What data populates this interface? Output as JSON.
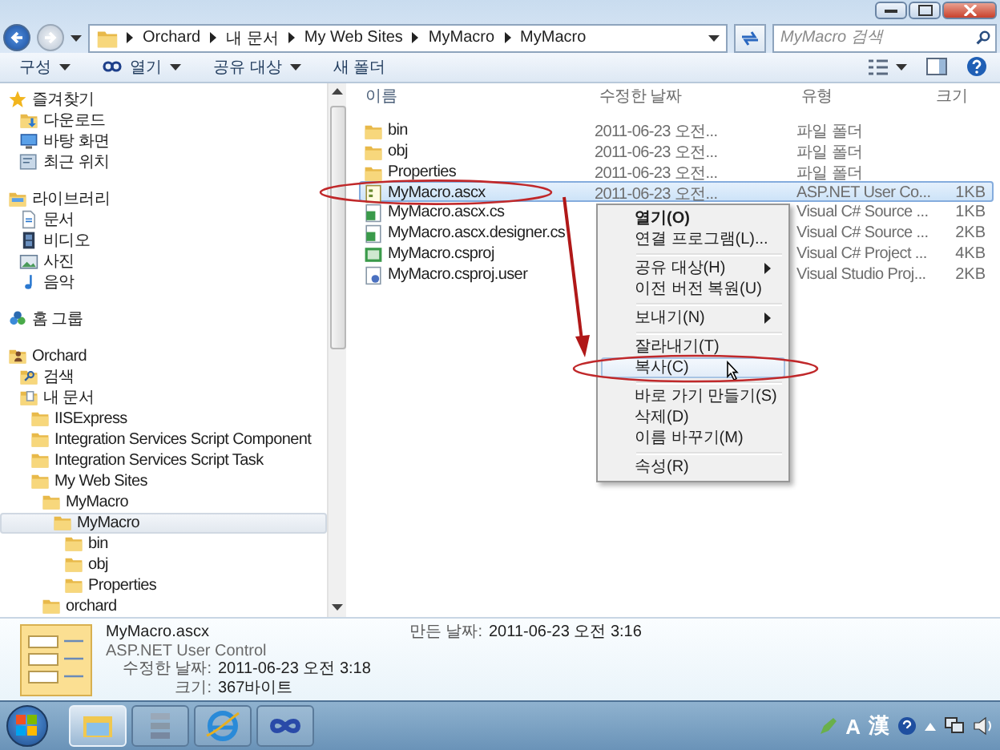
{
  "address_bar": {
    "crumbs": [
      "Orchard",
      "내 문서",
      "My Web Sites",
      "MyMacro",
      "MyMacro"
    ]
  },
  "search": {
    "placeholder": "MyMacro 검색"
  },
  "toolbar": {
    "buttons": [
      {
        "label": "구성",
        "kind": "menu"
      },
      {
        "label": "열기",
        "kind": "open"
      },
      {
        "label": "공유 대상",
        "kind": "menu"
      },
      {
        "label": "새 폴더",
        "kind": "plain"
      }
    ]
  },
  "nav": {
    "groups": [
      {
        "label": "즐겨찾기",
        "kind": "star",
        "selected": false,
        "children": [
          {
            "label": "다운로드",
            "kind": "download",
            "selected": false
          },
          {
            "label": "바탕 화면",
            "kind": "desktop",
            "selected": false
          },
          {
            "label": "최근 위치",
            "kind": "recent",
            "selected": false
          }
        ]
      },
      {
        "label": "라이브러리",
        "kind": "library",
        "selected": false,
        "children": [
          {
            "label": "문서",
            "kind": "document",
            "selected": false
          },
          {
            "label": "비디오",
            "kind": "video",
            "selected": false
          },
          {
            "label": "사진",
            "kind": "photo",
            "selected": false
          },
          {
            "label": "음악",
            "kind": "music",
            "selected": false
          }
        ]
      },
      {
        "label": "홈 그룹",
        "kind": "homegroup",
        "selected": false
      },
      {
        "label": "Orchard",
        "kind": "user",
        "selected": false,
        "children": [
          {
            "label": "검색",
            "kind": "search",
            "selected": false
          },
          {
            "label": "내 문서",
            "kind": "docfolder",
            "selected": false,
            "children": [
              {
                "label": "IISExpress",
                "kind": "folder",
                "selected": false
              },
              {
                "label": "Integration Services Script Component",
                "kind": "folder",
                "selected": false
              },
              {
                "label": "Integration Services Script Task",
                "kind": "folder",
                "selected": false
              },
              {
                "label": "My Web Sites",
                "kind": "folder",
                "selected": false,
                "children": [
                  {
                    "label": "MyMacro",
                    "kind": "folder",
                    "selected": false,
                    "children": [
                      {
                        "label": "MyMacro",
                        "kind": "folder",
                        "selected": true,
                        "children": [
                          {
                            "label": "bin",
                            "kind": "folder",
                            "selected": false
                          },
                          {
                            "label": "obj",
                            "kind": "folder",
                            "selected": false
                          },
                          {
                            "label": "Properties",
                            "kind": "folder",
                            "selected": false
                          }
                        ]
                      }
                    ]
                  },
                  {
                    "label": "orchard",
                    "kind": "folder",
                    "selected": false
                  }
                ]
              }
            ]
          }
        ]
      }
    ]
  },
  "files": {
    "columns": [
      "이름",
      "수정한 날짜",
      "유형",
      "크기"
    ],
    "rows": [
      {
        "name": "bin",
        "kind": "folder",
        "date": "2011-06-23 오전...",
        "type": "파일 폴더",
        "selected": false
      },
      {
        "name": "obj",
        "kind": "folder",
        "date": "2011-06-23 오전...",
        "type": "파일 폴더",
        "selected": false
      },
      {
        "name": "Properties",
        "kind": "folder",
        "date": "2011-06-23 오전...",
        "type": "파일 폴더",
        "selected": false
      },
      {
        "name": "MyMacro.ascx",
        "kind": "ascx",
        "date": "2011-06-23 오전...",
        "type": "ASP.NET User Co...",
        "size": "1KB",
        "selected": true
      },
      {
        "name": "MyMacro.ascx.cs",
        "kind": "cs",
        "type": "Visual C# Source ...",
        "size": "1KB",
        "selected": false
      },
      {
        "name": "MyMacro.ascx.designer.cs",
        "kind": "cs",
        "type": "Visual C# Source ...",
        "size": "2KB",
        "selected": false
      },
      {
        "name": "MyMacro.csproj",
        "kind": "csproj",
        "type": "Visual C# Project ...",
        "size": "4KB",
        "selected": false
      },
      {
        "name": "MyMacro.csproj.user",
        "kind": "user",
        "type": "Visual Studio Proj...",
        "size": "2KB",
        "selected": false
      }
    ]
  },
  "context_menu": {
    "items": [
      {
        "kind": "item",
        "label": "열기(O)",
        "bold": true,
        "submenu": false,
        "highlighted": false
      },
      {
        "kind": "item",
        "label": "연결 프로그램(L)...",
        "bold": false,
        "submenu": false,
        "highlighted": false
      },
      {
        "kind": "separator"
      },
      {
        "kind": "item",
        "label": "공유 대상(H)",
        "bold": false,
        "submenu": true,
        "highlighted": false
      },
      {
        "kind": "item",
        "label": "이전 버전 복원(U)",
        "bold": false,
        "submenu": false,
        "highlighted": false
      },
      {
        "kind": "separator"
      },
      {
        "kind": "item",
        "label": "보내기(N)",
        "bold": false,
        "submenu": true,
        "highlighted": false
      },
      {
        "kind": "separator"
      },
      {
        "kind": "item",
        "label": "잘라내기(T)",
        "bold": false,
        "submenu": false,
        "highlighted": false
      },
      {
        "kind": "item",
        "label": "복사(C)",
        "bold": false,
        "submenu": false,
        "highlighted": true
      },
      {
        "kind": "separator"
      },
      {
        "kind": "item",
        "label": "바로 가기 만들기(S)",
        "bold": false,
        "submenu": false,
        "highlighted": false
      },
      {
        "kind": "item",
        "label": "삭제(D)",
        "bold": false,
        "submenu": false,
        "highlighted": false
      },
      {
        "kind": "item",
        "label": "이름 바꾸기(M)",
        "bold": false,
        "submenu": false,
        "highlighted": false
      },
      {
        "kind": "separator"
      },
      {
        "kind": "item",
        "label": "속성(R)",
        "bold": false,
        "submenu": false,
        "highlighted": false
      }
    ]
  },
  "details": {
    "name": "MyMacro.ascx",
    "type": "ASP.NET User Control",
    "fields": [
      {
        "label": "수정한 날짜:",
        "value": "2011-06-23 오전 3:18"
      },
      {
        "label": "크기:",
        "value": "367바이트"
      }
    ],
    "created": {
      "label": "만든 날짜:",
      "value": "2011-06-23 오전 3:16"
    }
  },
  "taskbar": {
    "apps": [
      {
        "kind": "explorer",
        "active": true
      },
      {
        "kind": "stack",
        "active": false
      },
      {
        "kind": "browser",
        "active": false
      },
      {
        "kind": "infinity",
        "active": false
      }
    ],
    "tray": [
      "A",
      "漢"
    ]
  }
}
